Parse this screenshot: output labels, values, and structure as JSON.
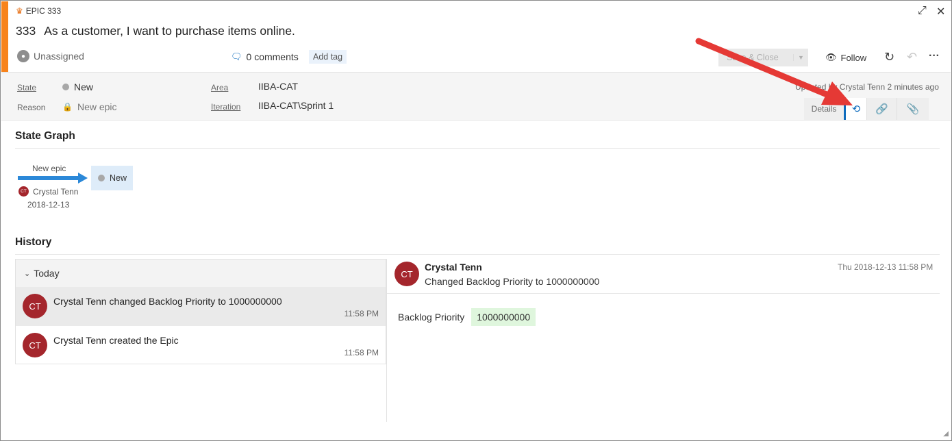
{
  "window": {
    "work_item_type": "EPIC 333",
    "id": "333",
    "title": "As a customer, I want to purchase items online."
  },
  "toolbar": {
    "assignee": "Unassigned",
    "comments": "0 comments",
    "add_tag": "Add tag",
    "save_close": "Save & Close",
    "follow": "Follow"
  },
  "fields": {
    "state_label": "State",
    "state_value": "New",
    "reason_label": "Reason",
    "reason_value": "New epic",
    "area_label": "Area",
    "area_value": "IIBA-CAT",
    "iteration_label": "Iteration",
    "iteration_value": "IIBA-CAT\\Sprint 1",
    "updated": "Updated by Crystal Tenn 2 minutes ago"
  },
  "tabs": {
    "details": "Details"
  },
  "state_graph": {
    "title": "State Graph",
    "transition_label": "New epic",
    "state": "New",
    "person_initials": "CT",
    "person": "Crystal Tenn",
    "date": "2018-12-13"
  },
  "history": {
    "title": "History",
    "group": "Today",
    "items": [
      {
        "initials": "CT",
        "text": "Crystal Tenn changed Backlog Priority to 1000000000",
        "time": "11:58 PM"
      },
      {
        "initials": "CT",
        "text": "Crystal Tenn created the Epic",
        "time": "11:58 PM"
      }
    ],
    "detail": {
      "initials": "CT",
      "name": "Crystal Tenn",
      "description": "Changed Backlog Priority to 1000000000",
      "timestamp": "Thu 2018-12-13 11:58 PM",
      "field": "Backlog Priority",
      "new_value": "1000000000"
    }
  },
  "colors": {
    "epic_accent": "#f7831c",
    "avatar": "#a4262c",
    "link_blue": "#0f6cbd",
    "annotation_arrow": "#e53935"
  },
  "icons": {
    "type": "crown-icon",
    "expand": "expand-icon",
    "close": "close-icon",
    "comment": "comment-icon",
    "follow": "eye-icon",
    "refresh": "refresh-icon",
    "undo": "undo-icon",
    "more": "more-icon",
    "history_tab": "history-icon",
    "links_tab": "link-icon",
    "attachments_tab": "paperclip-icon"
  }
}
